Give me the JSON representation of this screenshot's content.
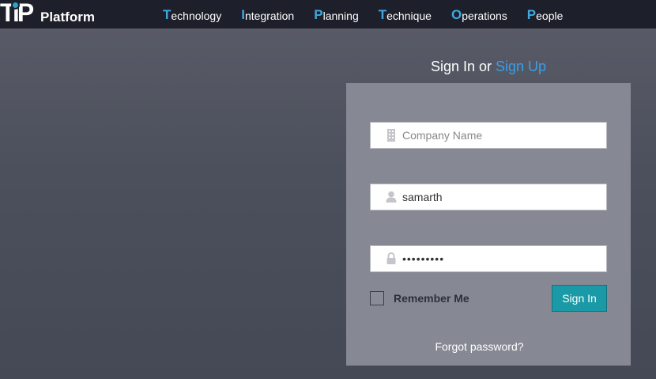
{
  "header": {
    "logo": {
      "mark": "TiP",
      "text": "Platform"
    },
    "nav": [
      {
        "initial": "T",
        "rest": "echnology"
      },
      {
        "initial": "I",
        "rest": "ntegration"
      },
      {
        "initial": "P",
        "rest": "lanning"
      },
      {
        "initial": "T",
        "rest": "echnique"
      },
      {
        "initial": "O",
        "rest": "perations"
      },
      {
        "initial": "P",
        "rest": "eople"
      }
    ]
  },
  "auth": {
    "heading_prefix": "Sign In or ",
    "signup_link": "Sign Up",
    "company": {
      "placeholder": "Company Name",
      "value": "",
      "icon": "building-icon"
    },
    "username": {
      "placeholder": "",
      "value": "samarth",
      "icon": "user-icon"
    },
    "password": {
      "placeholder": "",
      "value": "samarth12",
      "icon": "lock-icon"
    },
    "remember_label": "Remember Me",
    "remember_checked": false,
    "signin_label": "Sign In",
    "forgot_label": "Forgot password?"
  },
  "colors": {
    "topbar": "#1d1f2a",
    "accent_blue": "#3a9ee8",
    "button_teal": "#1a9aa6",
    "panel": "#868994",
    "background": "#4f525e"
  }
}
